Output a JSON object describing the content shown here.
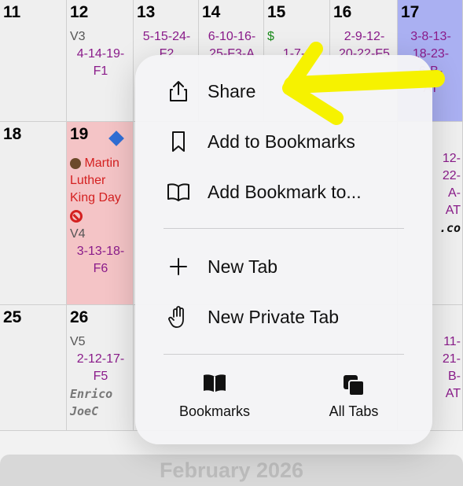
{
  "calendar": {
    "days": [
      {
        "num": "11",
        "lines": []
      },
      {
        "num": "12",
        "lines": [
          "V3",
          "4-14-19-",
          "F1"
        ]
      },
      {
        "num": "13",
        "lines": [
          "5-15-24-",
          "F2"
        ]
      },
      {
        "num": "14",
        "lines": [
          "6-10-16-",
          "25-F3-A"
        ]
      },
      {
        "num": "15",
        "lines": [
          "$",
          "1-7-1"
        ]
      },
      {
        "num": "16",
        "lines": [
          "2-9-12-",
          "20-22-F5"
        ]
      },
      {
        "num": "17",
        "lines": [
          "3-8-13-",
          "18-23-",
          "6-B-",
          "AT"
        ]
      },
      {
        "num": "18",
        "lines": []
      },
      {
        "num": "19",
        "event": "Martin Luther King Day",
        "lines": [
          "V4",
          "3-13-18-",
          "F6"
        ]
      },
      {
        "num": "25",
        "lines": []
      },
      {
        "num": "26",
        "lines": [
          "V5",
          "2-12-17-",
          "F5",
          "Enrico",
          "JoeC"
        ]
      }
    ],
    "right_col_row2": [
      "12-",
      "22-",
      "A-",
      "AT",
      ".co"
    ],
    "right_col_row3": [
      "11-",
      "21-",
      "B-",
      "AT"
    ],
    "month_footer": "February 2026"
  },
  "menu": {
    "items": [
      {
        "label": "Share",
        "icon": "share-icon"
      },
      {
        "label": "Add to Bookmarks",
        "icon": "bookmark-icon"
      },
      {
        "label": "Add Bookmark to...",
        "icon": "book-open-icon"
      },
      {
        "label": "New Tab",
        "icon": "plus-icon"
      },
      {
        "label": "New Private Tab",
        "icon": "hand-icon"
      }
    ],
    "bottom": [
      {
        "label": "Bookmarks",
        "icon": "book-icon"
      },
      {
        "label": "All Tabs",
        "icon": "tabs-icon"
      }
    ]
  },
  "colors": {
    "accent_blue": "#aab0f2",
    "holiday_pink": "#f4c4c6",
    "combo_purple": "#8a1b8a",
    "arrow_yellow": "#f6f200"
  }
}
